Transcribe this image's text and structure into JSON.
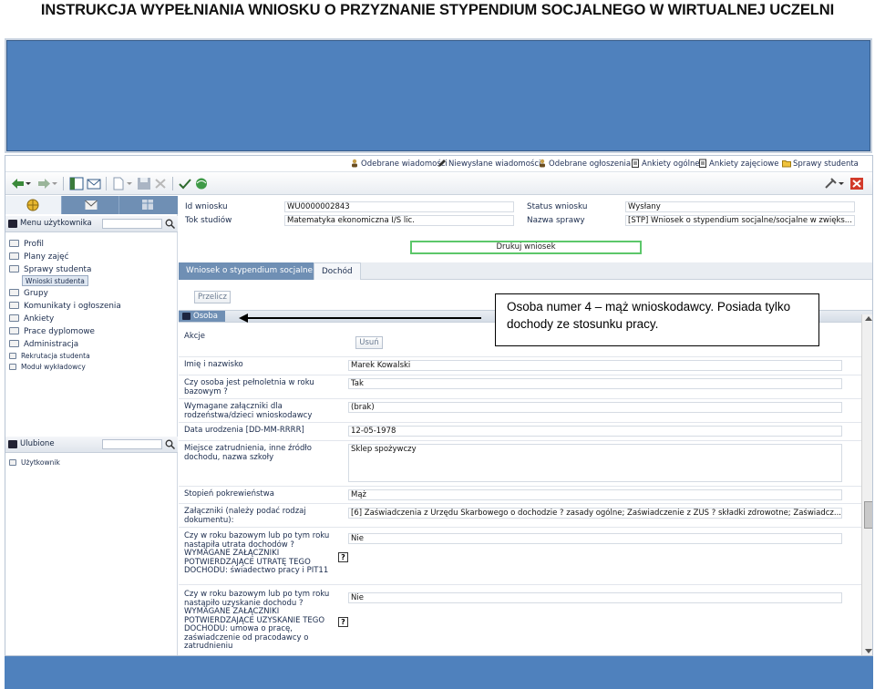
{
  "doc_title": "INSTRUKCJA WYPEŁNIANIA WNIOSKU O PRZYZNANIE STYPENDIUM SOCJALNEGO  W WIRTUALNEJ UCZELNI",
  "topnav": {
    "items": [
      "Odebrane wiadomości",
      "Niewysłane wiadomości",
      "Odebrane ogłoszenia",
      "Ankiety ogólne",
      "Ankiety zajęciowe",
      "Sprawy studenta"
    ]
  },
  "sidebar": {
    "menu_title": "Menu użytkownika",
    "items": [
      "Profil",
      "Plany zajęć",
      "Sprawy studenta",
      "Grupy",
      "Komunikaty i ogłoszenia",
      "Ankiety",
      "Prace dyplomowe",
      "Administracja",
      "Rekrutacja studenta",
      "Moduł wykładowcy"
    ],
    "sub_item": "Wnioski studenta",
    "fav_title": "Ulubione",
    "fav_items": [
      "Użytkownik"
    ]
  },
  "header": {
    "id_label": "Id wniosku",
    "id_value": "WU0000002843",
    "tok_label": "Tok studiów",
    "tok_value": "Matematyka ekonomiczna I/S lic.",
    "status_label": "Status wniosku",
    "status_value": "Wysłany",
    "sprawa_label": "Nazwa sprawy",
    "sprawa_value": "[STP] Wniosek o stypendium socjalne/socjalne w zwięks..."
  },
  "print_button": "Drukuj wniosek",
  "tabs": [
    "Wniosek o stypendium socjalne",
    "Dochód"
  ],
  "przelicz_button": "Przelicz",
  "section_title": "Osoba 4",
  "form": {
    "akcje_label": "Akcje",
    "usun_button": "Usuń",
    "name_label": "Imię i nazwisko",
    "name_value": "Marek Kowalski",
    "adult_label": "Czy osoba jest pełnoletnia w roku bazowym ?",
    "adult_value": "Tak",
    "req_label": "Wymagane załączniki dla rodzeństwa/dzieci wnioskodawcy",
    "req_value": "(brak)",
    "birth_label": "Data urodzenia [DD-MM-RRRR]",
    "birth_value": "12-05-1978",
    "job_label": "Miejsce zatrudnienia, inne źródło dochodu, nazwa szkoły",
    "job_value": "Sklep spożywczy",
    "rel_label": "Stopień pokrewieństwa",
    "rel_value": "Mąż",
    "att_label": "Załączniki (należy podać rodzaj dokumentu):",
    "att_value": "[6] Zaświadczenia z Urzędu Skarbowego o dochodzie ? zasady ogólne; Zaświadczenie z ZUS ? składki zdrowotne; Zaświadcz...",
    "loss_label": "Czy w roku bazowym lub po tym roku nastąpiła utrata dochodów ? WYMAGANE ZAŁĄCZNIKI POTWIERDZAJĄCE UTRATĘ TEGO DOCHODU: świadectwo pracy i PIT11",
    "loss_value": "Nie",
    "gain_label": "Czy w roku bazowym lub po tym roku nastąpiło uzyskanie dochodu ? WYMAGANE ZAŁĄCZNIKI POTWIERDZAJĄCE UZYSKANIE TEGO DOCHODU: umowa o pracę, zaświadczenie od pracodawcy o zatrudnieniu",
    "gain_value": "Nie",
    "help_glyph": "?"
  },
  "callout": "Osoba numer 4 – mąż wnioskodawcy. Posiada tylko dochody ze stosunku pracy.",
  "colors": {
    "banner": "#4f81bd",
    "tab_active": "#6f8fb4",
    "print_border": "#5cc76a"
  }
}
